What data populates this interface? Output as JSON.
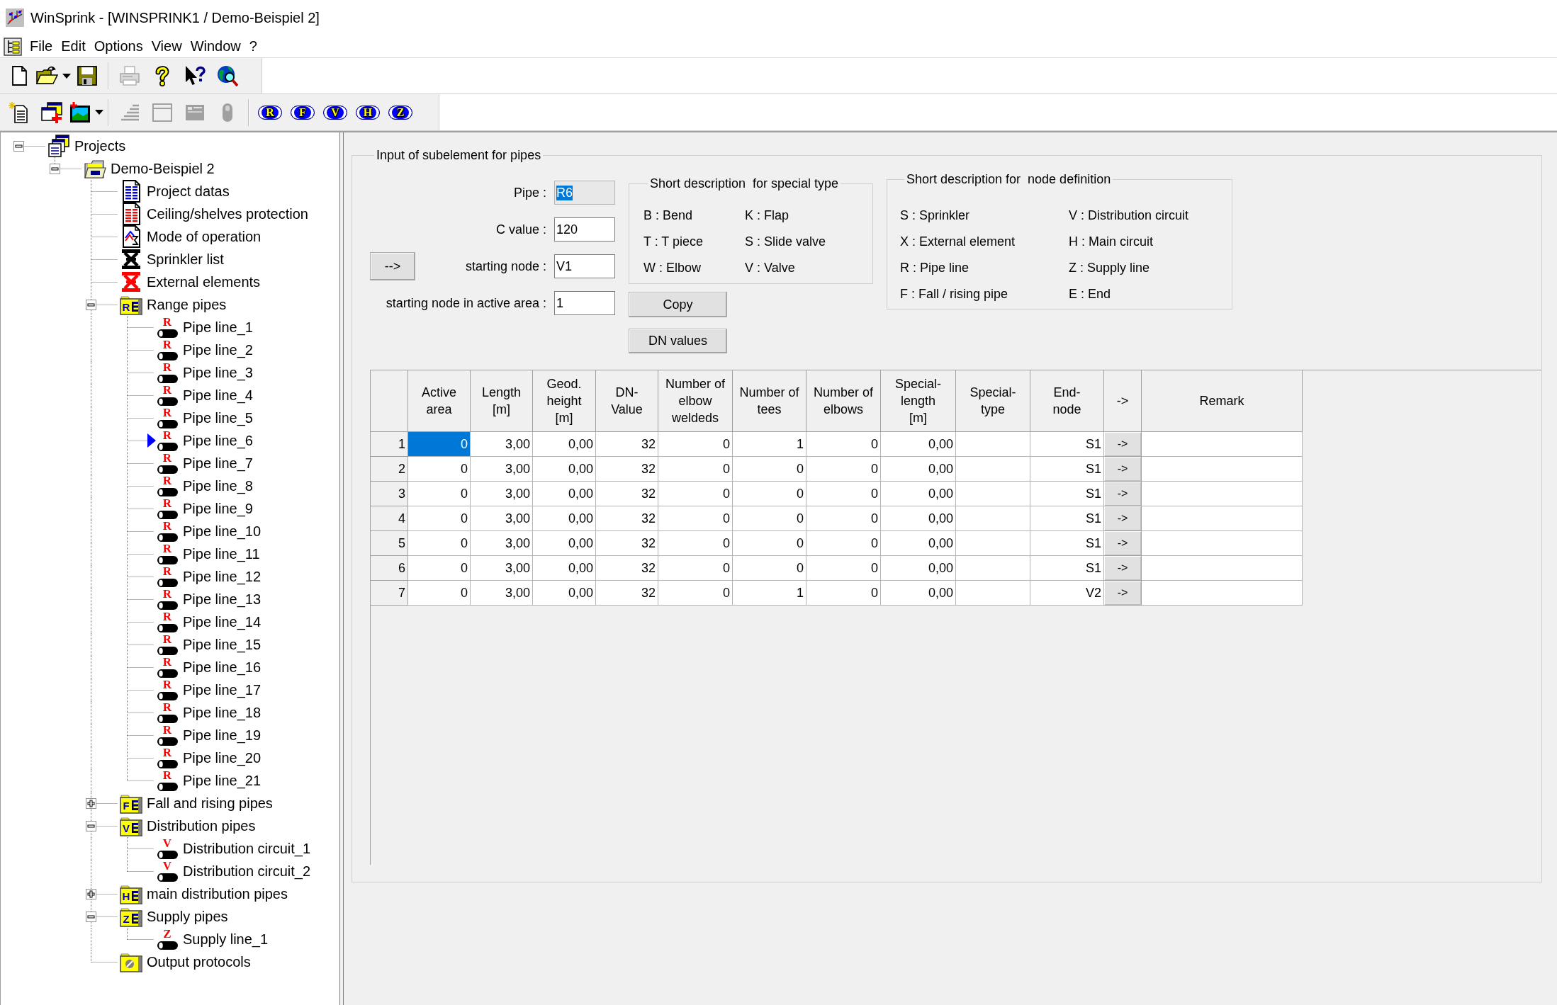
{
  "window": {
    "title": "WinSprink - [WINSPRINK1 / Demo-Beispiel 2]"
  },
  "menu": [
    "File",
    "Edit",
    "Options",
    "View",
    "Window",
    "?"
  ],
  "toolbar_1": [
    {
      "kind": "new-document",
      "disabled": false,
      "dropdown": false
    },
    {
      "kind": "open-folder",
      "disabled": false,
      "dropdown": true
    },
    {
      "kind": "save",
      "disabled": false,
      "dropdown": false
    },
    {
      "kind": "separator"
    },
    {
      "kind": "print",
      "disabled": true,
      "dropdown": false
    },
    {
      "kind": "help",
      "disabled": false,
      "dropdown": false
    },
    {
      "kind": "context-help",
      "disabled": false,
      "dropdown": false
    },
    {
      "kind": "web-search",
      "disabled": false,
      "dropdown": false
    }
  ],
  "toolbar_2": [
    {
      "kind": "new-item",
      "disabled": false,
      "dropdown": false
    },
    {
      "kind": "copy-add",
      "disabled": false,
      "dropdown": false
    },
    {
      "kind": "picture-add",
      "disabled": false,
      "dropdown": true
    },
    {
      "kind": "separator"
    },
    {
      "kind": "stairs",
      "disabled": true,
      "dropdown": false
    },
    {
      "kind": "window",
      "disabled": true,
      "dropdown": false
    },
    {
      "kind": "panel",
      "disabled": true,
      "dropdown": false
    },
    {
      "kind": "pill",
      "disabled": true,
      "dropdown": false
    },
    {
      "kind": "separator"
    },
    {
      "kind": "letter",
      "label": "R",
      "disabled": false
    },
    {
      "kind": "letter",
      "label": "F",
      "disabled": false
    },
    {
      "kind": "letter",
      "label": "V",
      "disabled": false
    },
    {
      "kind": "letter",
      "label": "H",
      "disabled": false
    },
    {
      "kind": "letter",
      "label": "Z",
      "disabled": false
    }
  ],
  "tree": [
    {
      "label": "Projects",
      "kind": "projects",
      "expanded": true,
      "selected": false,
      "children": [
        {
          "label": "Demo-Beispiel 2",
          "kind": "project",
          "expanded": true,
          "selected": false,
          "children": [
            {
              "label": "Project datas",
              "kind": "data-sheet",
              "selected": false
            },
            {
              "label": "Ceiling/shelves protection",
              "kind": "protection-sheet",
              "selected": false
            },
            {
              "label": "Mode of operation",
              "kind": "diagram-sheet",
              "selected": false
            },
            {
              "label": "Sprinkler list",
              "kind": "sprinkler",
              "selected": false
            },
            {
              "label": "External elements",
              "kind": "external-element",
              "selected": false
            },
            {
              "label": "Range pipes",
              "kind": "folder",
              "letter": "R",
              "expanded": true,
              "selected": false,
              "children": [
                {
                  "label": "Pipe line_1",
                  "kind": "pipe",
                  "letter": "R",
                  "selected": false
                },
                {
                  "label": "Pipe line_2",
                  "kind": "pipe",
                  "letter": "R",
                  "selected": false
                },
                {
                  "label": "Pipe line_3",
                  "kind": "pipe",
                  "letter": "R",
                  "selected": false
                },
                {
                  "label": "Pipe line_4",
                  "kind": "pipe",
                  "letter": "R",
                  "selected": false
                },
                {
                  "label": "Pipe line_5",
                  "kind": "pipe",
                  "letter": "R",
                  "selected": false
                },
                {
                  "label": "Pipe line_6",
                  "kind": "pipe",
                  "letter": "R",
                  "selected": true
                },
                {
                  "label": "Pipe line_7",
                  "kind": "pipe",
                  "letter": "R",
                  "selected": false
                },
                {
                  "label": "Pipe line_8",
                  "kind": "pipe",
                  "letter": "R",
                  "selected": false
                },
                {
                  "label": "Pipe line_9",
                  "kind": "pipe",
                  "letter": "R",
                  "selected": false
                },
                {
                  "label": "Pipe line_10",
                  "kind": "pipe",
                  "letter": "R",
                  "selected": false
                },
                {
                  "label": "Pipe line_11",
                  "kind": "pipe",
                  "letter": "R",
                  "selected": false
                },
                {
                  "label": "Pipe line_12",
                  "kind": "pipe",
                  "letter": "R",
                  "selected": false
                },
                {
                  "label": "Pipe line_13",
                  "kind": "pipe",
                  "letter": "R",
                  "selected": false
                },
                {
                  "label": "Pipe line_14",
                  "kind": "pipe",
                  "letter": "R",
                  "selected": false
                },
                {
                  "label": "Pipe line_15",
                  "kind": "pipe",
                  "letter": "R",
                  "selected": false
                },
                {
                  "label": "Pipe line_16",
                  "kind": "pipe",
                  "letter": "R",
                  "selected": false
                },
                {
                  "label": "Pipe line_17",
                  "kind": "pipe",
                  "letter": "R",
                  "selected": false
                },
                {
                  "label": "Pipe line_18",
                  "kind": "pipe",
                  "letter": "R",
                  "selected": false
                },
                {
                  "label": "Pipe line_19",
                  "kind": "pipe",
                  "letter": "R",
                  "selected": false
                },
                {
                  "label": "Pipe line_20",
                  "kind": "pipe",
                  "letter": "R",
                  "selected": false
                },
                {
                  "label": "Pipe line_21",
                  "kind": "pipe",
                  "letter": "R",
                  "selected": false
                }
              ]
            },
            {
              "label": "Fall and rising pipes",
              "kind": "folder",
              "letter": "F",
              "expanded": false,
              "selected": false
            },
            {
              "label": "Distribution pipes",
              "kind": "folder",
              "letter": "V",
              "expanded": true,
              "selected": false,
              "children": [
                {
                  "label": "Distribution circuit_1",
                  "kind": "pipe",
                  "letter": "V",
                  "selected": false
                },
                {
                  "label": "Distribution circuit_2",
                  "kind": "pipe",
                  "letter": "V",
                  "selected": false
                }
              ]
            },
            {
              "label": "main distribution pipes",
              "kind": "folder",
              "letter": "H",
              "expanded": false,
              "selected": false
            },
            {
              "label": "Supply pipes",
              "kind": "folder",
              "letter": "Z",
              "expanded": true,
              "selected": false,
              "children": [
                {
                  "label": "Supply line_1",
                  "kind": "pipe",
                  "letter": "Z",
                  "selected": false
                }
              ]
            },
            {
              "label": "Output protocols",
              "kind": "protocols",
              "selected": false
            }
          ]
        }
      ]
    }
  ],
  "input_panel": {
    "title": "Input of subelement for pipes",
    "fields": [
      {
        "label": "Pipe :",
        "value": "R6",
        "kind": "readonly",
        "selected": true
      },
      {
        "label": "C value :",
        "value": "120",
        "kind": "input",
        "selected": false
      },
      {
        "label": "starting node :",
        "value": "V1",
        "kind": "input",
        "selected": false,
        "button": "-->"
      },
      {
        "label": "starting node in active area :",
        "value": "1",
        "kind": "input",
        "selected": false
      }
    ],
    "special_types": {
      "title": "Short description  for special type",
      "items": [
        "B : Bend",
        "K : Flap",
        "T : T piece",
        "S : Slide valve",
        "W : Elbow",
        "V : Valve"
      ]
    },
    "buttons": [
      "Copy",
      "DN values"
    ],
    "node_definitions": {
      "title": "Short description for  node definition",
      "items": [
        "S : Sprinkler",
        "V : Distribution circuit",
        "X : External element",
        "H : Main circuit",
        "R : Pipe line",
        "Z : Supply line",
        "F : Fall / rising pipe",
        "E : End"
      ]
    }
  },
  "table": {
    "columns": [
      "Active\narea",
      "Length\n[m]",
      "Geod.\nheight\n[m]",
      "DN-\nValue",
      "Number of\nelbow\nweldeds",
      "Number of\ntees",
      "Number of\nelbows",
      "Special-\nlength\n[m]",
      "Special-\ntype",
      "End-\nnode",
      "->",
      "Remark"
    ],
    "rows": [
      {
        "number": "1",
        "cells": [
          {
            "kind": "text",
            "text": "0",
            "selected": true
          },
          {
            "kind": "text",
            "text": "3,00",
            "selected": false
          },
          {
            "kind": "text",
            "text": "0,00",
            "selected": false
          },
          {
            "kind": "text",
            "text": "32",
            "selected": false
          },
          {
            "kind": "text",
            "text": "0",
            "selected": false
          },
          {
            "kind": "text",
            "text": "1",
            "selected": false
          },
          {
            "kind": "text",
            "text": "0",
            "selected": false
          },
          {
            "kind": "text",
            "text": "0,00",
            "selected": false
          },
          {
            "kind": "text",
            "selected": false
          },
          {
            "kind": "text",
            "text": "S1",
            "selected": false
          },
          {
            "kind": "button",
            "text": "->",
            "selected": false
          },
          {
            "kind": "text",
            "selected": false
          }
        ]
      },
      {
        "number": "2",
        "cells": [
          {
            "kind": "text",
            "text": "0",
            "selected": false
          },
          {
            "kind": "text",
            "text": "3,00",
            "selected": false
          },
          {
            "kind": "text",
            "text": "0,00",
            "selected": false
          },
          {
            "kind": "text",
            "text": "32",
            "selected": false
          },
          {
            "kind": "text",
            "text": "0",
            "selected": false
          },
          {
            "kind": "text",
            "text": "0",
            "selected": false
          },
          {
            "kind": "text",
            "text": "0",
            "selected": false
          },
          {
            "kind": "text",
            "text": "0,00",
            "selected": false
          },
          {
            "kind": "text",
            "selected": false
          },
          {
            "kind": "text",
            "text": "S1",
            "selected": false
          },
          {
            "kind": "button",
            "text": "->",
            "selected": false
          },
          {
            "kind": "text",
            "selected": false
          }
        ]
      },
      {
        "number": "3",
        "cells": [
          {
            "kind": "text",
            "text": "0",
            "selected": false
          },
          {
            "kind": "text",
            "text": "3,00",
            "selected": false
          },
          {
            "kind": "text",
            "text": "0,00",
            "selected": false
          },
          {
            "kind": "text",
            "text": "32",
            "selected": false
          },
          {
            "kind": "text",
            "text": "0",
            "selected": false
          },
          {
            "kind": "text",
            "text": "0",
            "selected": false
          },
          {
            "kind": "text",
            "text": "0",
            "selected": false
          },
          {
            "kind": "text",
            "text": "0,00",
            "selected": false
          },
          {
            "kind": "text",
            "selected": false
          },
          {
            "kind": "text",
            "text": "S1",
            "selected": false
          },
          {
            "kind": "button",
            "text": "->",
            "selected": false
          },
          {
            "kind": "text",
            "selected": false
          }
        ]
      },
      {
        "number": "4",
        "cells": [
          {
            "kind": "text",
            "text": "0",
            "selected": false
          },
          {
            "kind": "text",
            "text": "3,00",
            "selected": false
          },
          {
            "kind": "text",
            "text": "0,00",
            "selected": false
          },
          {
            "kind": "text",
            "text": "32",
            "selected": false
          },
          {
            "kind": "text",
            "text": "0",
            "selected": false
          },
          {
            "kind": "text",
            "text": "0",
            "selected": false
          },
          {
            "kind": "text",
            "text": "0",
            "selected": false
          },
          {
            "kind": "text",
            "text": "0,00",
            "selected": false
          },
          {
            "kind": "text",
            "selected": false
          },
          {
            "kind": "text",
            "text": "S1",
            "selected": false
          },
          {
            "kind": "button",
            "text": "->",
            "selected": false
          },
          {
            "kind": "text",
            "selected": false
          }
        ]
      },
      {
        "number": "5",
        "cells": [
          {
            "kind": "text",
            "text": "0",
            "selected": false
          },
          {
            "kind": "text",
            "text": "3,00",
            "selected": false
          },
          {
            "kind": "text",
            "text": "0,00",
            "selected": false
          },
          {
            "kind": "text",
            "text": "32",
            "selected": false
          },
          {
            "kind": "text",
            "text": "0",
            "selected": false
          },
          {
            "kind": "text",
            "text": "0",
            "selected": false
          },
          {
            "kind": "text",
            "text": "0",
            "selected": false
          },
          {
            "kind": "text",
            "text": "0,00",
            "selected": false
          },
          {
            "kind": "text",
            "selected": false
          },
          {
            "kind": "text",
            "text": "S1",
            "selected": false
          },
          {
            "kind": "button",
            "text": "->",
            "selected": false
          },
          {
            "kind": "text",
            "selected": false
          }
        ]
      },
      {
        "number": "6",
        "cells": [
          {
            "kind": "text",
            "text": "0",
            "selected": false
          },
          {
            "kind": "text",
            "text": "3,00",
            "selected": false
          },
          {
            "kind": "text",
            "text": "0,00",
            "selected": false
          },
          {
            "kind": "text",
            "text": "32",
            "selected": false
          },
          {
            "kind": "text",
            "text": "0",
            "selected": false
          },
          {
            "kind": "text",
            "text": "0",
            "selected": false
          },
          {
            "kind": "text",
            "text": "0",
            "selected": false
          },
          {
            "kind": "text",
            "text": "0,00",
            "selected": false
          },
          {
            "kind": "text",
            "selected": false
          },
          {
            "kind": "text",
            "text": "S1",
            "selected": false
          },
          {
            "kind": "button",
            "text": "->",
            "selected": false
          },
          {
            "kind": "text",
            "selected": false
          }
        ]
      },
      {
        "number": "7",
        "cells": [
          {
            "kind": "text",
            "text": "0",
            "selected": false
          },
          {
            "kind": "text",
            "text": "3,00",
            "selected": false
          },
          {
            "kind": "text",
            "text": "0,00",
            "selected": false
          },
          {
            "kind": "text",
            "text": "32",
            "selected": false
          },
          {
            "kind": "text",
            "text": "0",
            "selected": false
          },
          {
            "kind": "text",
            "text": "1",
            "selected": false
          },
          {
            "kind": "text",
            "text": "0",
            "selected": false
          },
          {
            "kind": "text",
            "text": "0,00",
            "selected": false
          },
          {
            "kind": "text",
            "selected": false
          },
          {
            "kind": "text",
            "text": "V2",
            "selected": false
          },
          {
            "kind": "button",
            "text": "->",
            "selected": false
          },
          {
            "kind": "text",
            "selected": false
          }
        ]
      }
    ]
  }
}
